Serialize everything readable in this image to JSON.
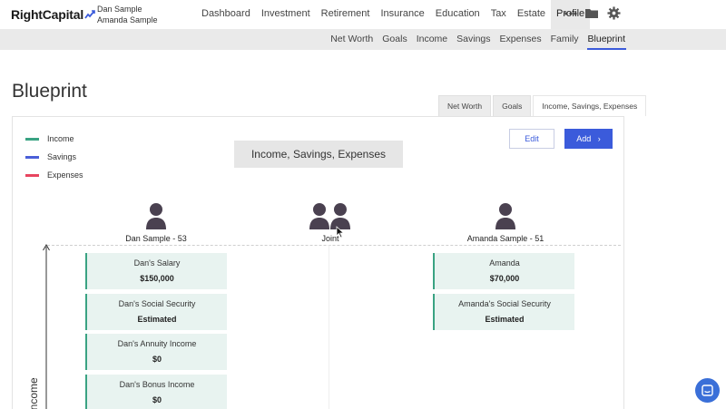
{
  "app": {
    "logo": "RightCapital",
    "users": [
      "Dan Sample",
      "Amanda Sample"
    ]
  },
  "nav": {
    "items": [
      "Dashboard",
      "Investment",
      "Retirement",
      "Insurance",
      "Education",
      "Tax",
      "Estate",
      "Profile"
    ],
    "active": "Profile",
    "icons": [
      "more-icon",
      "folder-icon",
      "gear-icon"
    ]
  },
  "subnav": {
    "items": [
      "Net Worth",
      "Goals",
      "Income",
      "Savings",
      "Expenses",
      "Family",
      "Blueprint"
    ],
    "active": "Blueprint"
  },
  "page": {
    "title": "Blueprint",
    "tabs": [
      "Net Worth",
      "Goals",
      "Income, Savings, Expenses"
    ],
    "active_tab": "Income, Savings, Expenses"
  },
  "legend": [
    {
      "label": "Income",
      "color": "#3aa383"
    },
    {
      "label": "Savings",
      "color": "#4a5fd8"
    },
    {
      "label": "Expenses",
      "color": "#e8455f"
    }
  ],
  "chart_title": "Income, Savings, Expenses",
  "buttons": {
    "edit": "Edit",
    "add": "Add"
  },
  "people": [
    {
      "label": "Dan Sample - 53"
    },
    {
      "label": "Joint"
    },
    {
      "label": "Amanda Sample - 51"
    }
  ],
  "axis_label": "Income",
  "income_cards": {
    "dan": [
      {
        "name": "Dan's Salary",
        "value": "$150,000"
      },
      {
        "name": "Dan's Social Security",
        "value": "Estimated"
      },
      {
        "name": "Dan's Annuity Income",
        "value": "$0"
      },
      {
        "name": "Dan's Bonus Income",
        "value": "$0"
      }
    ],
    "amanda": [
      {
        "name": "Amanda",
        "value": "$70,000"
      },
      {
        "name": "Amanda's Social Security",
        "value": "Estimated"
      }
    ]
  },
  "colors": {
    "accent": "#3b5bdb",
    "income": "#3aa383",
    "card_bg": "#e8f3f0",
    "person": "#4a4150"
  }
}
